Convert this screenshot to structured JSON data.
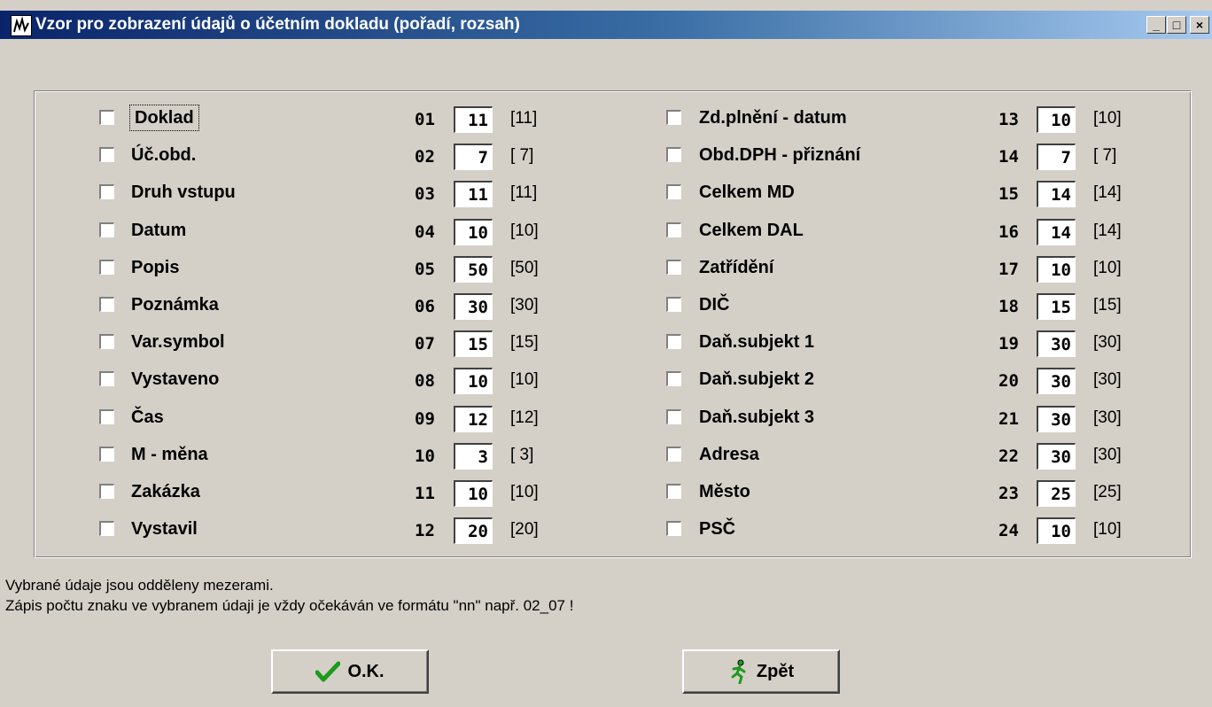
{
  "window": {
    "title": "Vzor pro zobrazení údajů o účetním dokladu (pořadí, rozsah)",
    "minimize": "_",
    "maximize": "□",
    "close": "×"
  },
  "fields": [
    {
      "label": "Doklad",
      "num": "01",
      "value": "11",
      "max": "[11]",
      "checked": false
    },
    {
      "label": "Úč.obd.",
      "num": "02",
      "value": "7",
      "max": "[ 7]",
      "checked": false
    },
    {
      "label": "Druh vstupu",
      "num": "03",
      "value": "11",
      "max": "[11]",
      "checked": false
    },
    {
      "label": "Datum",
      "num": "04",
      "value": "10",
      "max": "[10]",
      "checked": false
    },
    {
      "label": "Popis",
      "num": "05",
      "value": "50",
      "max": "[50]",
      "checked": false
    },
    {
      "label": "Poznámka",
      "num": "06",
      "value": "30",
      "max": "[30]",
      "checked": false
    },
    {
      "label": "Var.symbol",
      "num": "07",
      "value": "15",
      "max": "[15]",
      "checked": false
    },
    {
      "label": "Vystaveno",
      "num": "08",
      "value": "10",
      "max": "[10]",
      "checked": false
    },
    {
      "label": "Čas",
      "num": "09",
      "value": "12",
      "max": "[12]",
      "checked": false
    },
    {
      "label": "M - měna",
      "num": "10",
      "value": "3",
      "max": "[ 3]",
      "checked": false
    },
    {
      "label": "Zakázka",
      "num": "11",
      "value": "10",
      "max": "[10]",
      "checked": false
    },
    {
      "label": "Vystavil",
      "num": "12",
      "value": "20",
      "max": "[20]",
      "checked": false
    },
    {
      "label": "Zd.plnění - datum",
      "num": "13",
      "value": "10",
      "max": "[10]",
      "checked": false
    },
    {
      "label": "Obd.DPH - přiznání",
      "num": "14",
      "value": "7",
      "max": "[ 7]",
      "checked": false
    },
    {
      "label": "Celkem MD",
      "num": "15",
      "value": "14",
      "max": "[14]",
      "checked": false
    },
    {
      "label": "Celkem DAL",
      "num": "16",
      "value": "14",
      "max": "[14]",
      "checked": false
    },
    {
      "label": "Zatřídění",
      "num": "17",
      "value": "10",
      "max": "[10]",
      "checked": false
    },
    {
      "label": "DIČ",
      "num": "18",
      "value": "15",
      "max": "[15]",
      "checked": false
    },
    {
      "label": "Daň.subjekt 1",
      "num": "19",
      "value": "30",
      "max": "[30]",
      "checked": false
    },
    {
      "label": "Daň.subjekt 2",
      "num": "20",
      "value": "30",
      "max": "[30]",
      "checked": false
    },
    {
      "label": "Daň.subjekt 3",
      "num": "21",
      "value": "30",
      "max": "[30]",
      "checked": false
    },
    {
      "label": "Adresa",
      "num": "22",
      "value": "30",
      "max": "[30]",
      "checked": false
    },
    {
      "label": "Město",
      "num": "23",
      "value": "25",
      "max": "[25]",
      "checked": false
    },
    {
      "label": "PSČ",
      "num": "24",
      "value": "10",
      "max": "[10]",
      "checked": false
    }
  ],
  "notes": {
    "line1": "Vybrané údaje jsou odděleny mezerami.",
    "line2": "Zápis počtu znaku ve vybranem údaji je vždy očekáván ve formátu \"nn\" např. 02_07 !"
  },
  "buttons": {
    "ok_label": "O.K.",
    "ok_icon": "checkmark-icon",
    "back_label": "Zpět",
    "back_icon": "running-man-icon"
  },
  "colors": {
    "window_bg": "#d4d0c8",
    "title_start": "#0a246a",
    "title_end": "#a6caf0",
    "check_green": "#1e9a1e"
  }
}
